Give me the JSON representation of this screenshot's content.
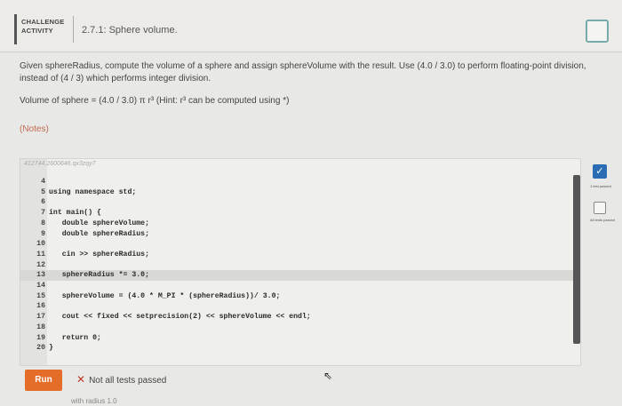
{
  "header": {
    "badge_line1": "CHALLENGE",
    "badge_line2": "ACTIVITY",
    "title": "2.7.1: Sphere volume."
  },
  "description": "Given sphereRadius, compute the volume of a sphere and assign sphereVolume with the result. Use (4.0 / 3.0) to perform floating-point division, instead of (4 / 3) which performs integer division.",
  "formula": "Volume of sphere = (4.0 / 3.0) π r³ (Hint: r³ can be computed using *)",
  "notes": "(Notes)",
  "editor": {
    "id_text": "412744.2600646.qx3zqy7",
    "lines": [
      {
        "n": "4",
        "code": ""
      },
      {
        "n": "5",
        "code": "using namespace std;"
      },
      {
        "n": "6",
        "code": ""
      },
      {
        "n": "7",
        "code": "int main() {"
      },
      {
        "n": "8",
        "code": "   double sphereVolume;"
      },
      {
        "n": "9",
        "code": "   double sphereRadius;"
      },
      {
        "n": "10",
        "code": ""
      },
      {
        "n": "11",
        "code": "   cin >> sphereRadius;"
      },
      {
        "n": "12",
        "code": ""
      },
      {
        "n": "13",
        "code": "   sphereRadius *= 3.0;"
      },
      {
        "n": "14",
        "code": ""
      },
      {
        "n": "15",
        "code": "   sphereVolume = (4.0 * M_PI * (sphereRadius))/ 3.0;"
      },
      {
        "n": "16",
        "code": ""
      },
      {
        "n": "17",
        "code": "   cout << fixed << setprecision(2) << sphereVolume << endl;"
      },
      {
        "n": "18",
        "code": ""
      },
      {
        "n": "19",
        "code": "   return 0;"
      },
      {
        "n": "20",
        "code": "}"
      }
    ],
    "active_line_index": 9
  },
  "side": {
    "test1_label": "1 test passed",
    "all_label": "All tests passed"
  },
  "run_label": "Run",
  "result_text": "Not all tests passed",
  "bottom_text": "with radius 1.0",
  "colors": {
    "run_button": "#e46d2a",
    "notes": "#c06b52",
    "check": "#2a6db5"
  }
}
